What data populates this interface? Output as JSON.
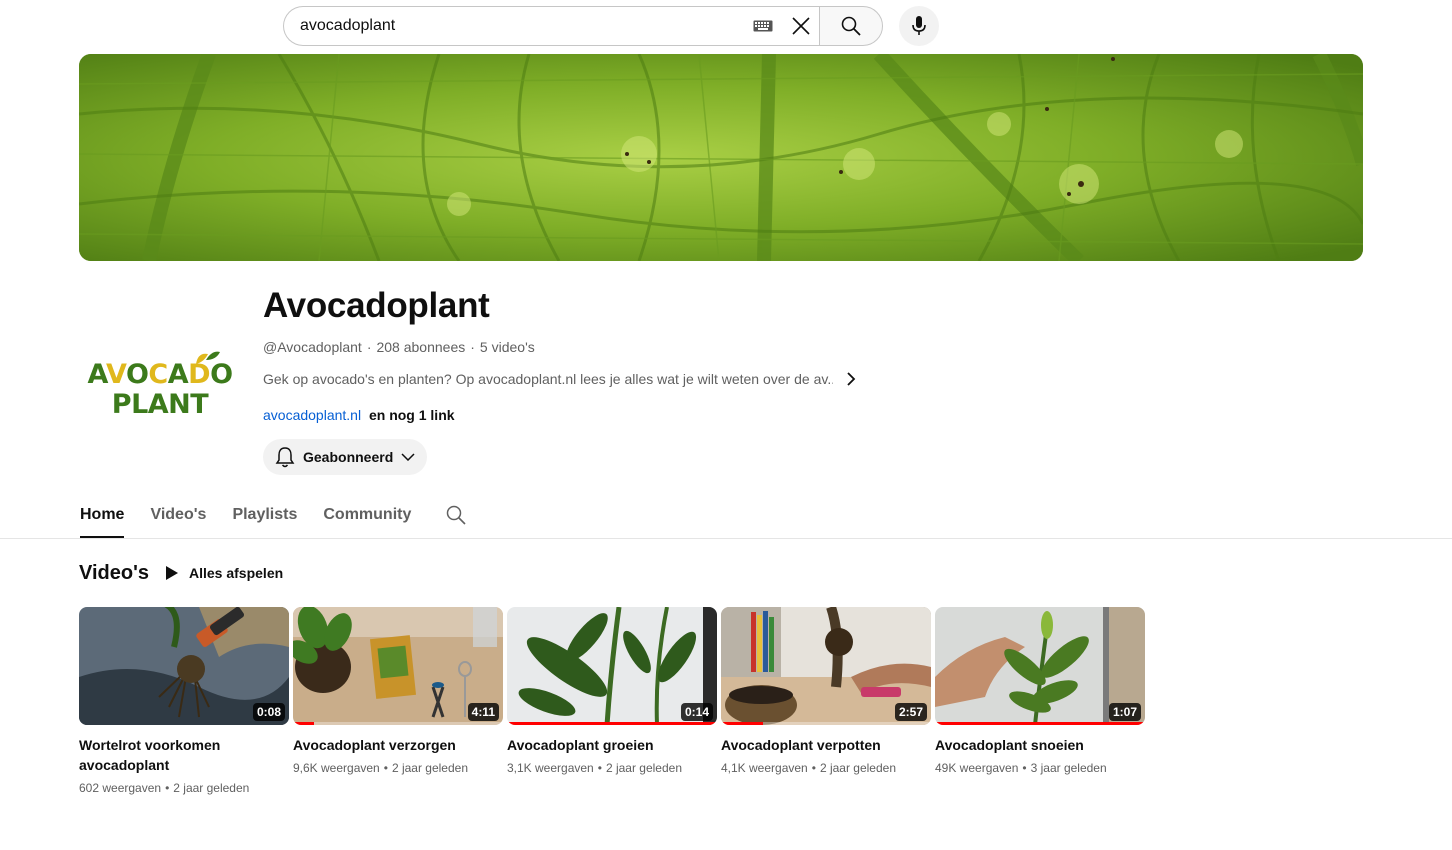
{
  "search": {
    "query": "avocadoplant"
  },
  "channel": {
    "name": "Avocadoplant",
    "logo_line1": "AVOCADO",
    "logo_line2": "PLANT",
    "handle": "@Avocadoplant",
    "subscribers": "208 abonnees",
    "video_count": "5 video's",
    "description": "Gek op avocado's en planten? Op avocadoplant.nl lees je alles wat je wilt weten over de av...",
    "link_text": "avocadoplant.nl",
    "more_links": "en nog 1 link",
    "subscribe_label": "Geabonneerd"
  },
  "tabs": [
    {
      "label": "Home"
    },
    {
      "label": "Video's"
    },
    {
      "label": "Playlists"
    },
    {
      "label": "Community"
    }
  ],
  "section": {
    "title": "Video's",
    "play_all": "Alles afspelen"
  },
  "videos": [
    {
      "title": "Wortelrot voorkomen avocadoplant",
      "duration": "0:08",
      "views": "602 weergaven",
      "age": "2 jaar geleden",
      "watched": 0
    },
    {
      "title": "Avocadoplant verzorgen",
      "duration": "4:11",
      "views": "9,6K weergaven",
      "age": "2 jaar geleden",
      "watched": 0.1
    },
    {
      "title": "Avocadoplant groeien",
      "duration": "0:14",
      "views": "3,1K weergaven",
      "age": "2 jaar geleden",
      "watched": 1
    },
    {
      "title": "Avocadoplant verpotten",
      "duration": "2:57",
      "views": "4,1K weergaven",
      "age": "2 jaar geleden",
      "watched": 0.2
    },
    {
      "title": "Avocadoplant snoeien",
      "duration": "1:07",
      "views": "49K weergaven",
      "age": "3 jaar geleden",
      "watched": 1
    }
  ],
  "colors": {
    "brand_green": "#3c7a1b",
    "logo_yellow": "#e0b81c",
    "link_blue": "#065fd4",
    "progress_red": "#ff0000"
  }
}
